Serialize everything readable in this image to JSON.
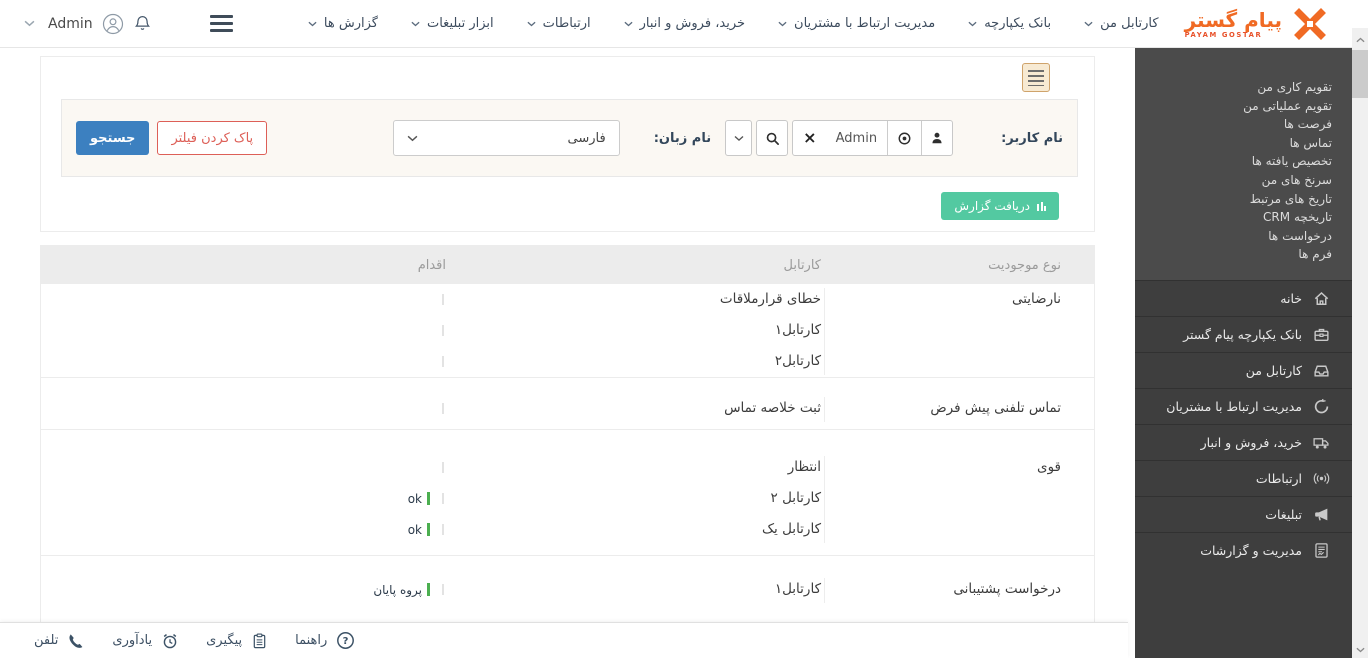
{
  "colors": {
    "accent_orange": "#f06a24",
    "primary_blue": "#3c80c0",
    "danger_red": "#dd5f57",
    "success_green": "#53c9a1",
    "action_green_bar": "#4caf50",
    "sidebar_dark": "#3e3e3e",
    "sidebar_light": "#4b4b4b"
  },
  "topbar": {
    "user_menu": {
      "name": "Admin"
    },
    "nav_items": [
      "کارتابل من",
      "بانک یکپارچه",
      "مدیریت ارتباط با مشتریان",
      "خرید، فروش و انبار",
      "ارتباطات",
      "ابزار تبلیغات",
      "گزارش ها"
    ],
    "logo": {
      "title": "پیام گستر",
      "subtitle": "PAYAM GOSTAR"
    }
  },
  "sidebar": {
    "quick_links": [
      "تقویم کاری من",
      "تقویم عملیاتی من",
      "فرصت ها",
      "تماس ها",
      "تخصیص یافته ها",
      "سرنخ های من",
      "تاریخ های مرتبط",
      "تاریخچه CRM",
      "درخواست ها",
      "فرم ها"
    ],
    "menu_items": [
      {
        "label": "خانه",
        "icon": "home-icon"
      },
      {
        "label": "بانک یکپارچه پیام گستر",
        "icon": "bank-icon"
      },
      {
        "label": "کارتابل من",
        "icon": "cartable-icon"
      },
      {
        "label": "مدیریت ارتباط با مشتریان",
        "icon": "crm-icon"
      },
      {
        "label": "خرید، فروش و انبار",
        "icon": "truck-icon"
      },
      {
        "label": "ارتباطات",
        "icon": "broadcast-icon"
      },
      {
        "label": "تبلیغات",
        "icon": "megaphone-icon"
      },
      {
        "label": "مدیریت و گزارشات",
        "icon": "reports-icon"
      }
    ]
  },
  "filter_panel": {
    "user_label": "نام کاربر:",
    "user_value": "Admin",
    "language_label": "نام زبان:",
    "language_value": "فارسی",
    "search_button": "جستجو",
    "clear_filter_button": "پاک کردن فیلتر",
    "get_report_button": "دریافت گزارش"
  },
  "table": {
    "headers": {
      "entity_type": "نوع موجودیت",
      "cartable": "کارتابل",
      "action": "اقدام"
    },
    "groups": [
      {
        "entity_type": "نارضایتی",
        "rows": [
          {
            "cartable": "خطای قرارملاقات",
            "action": ""
          },
          {
            "cartable": "کارتابل۱",
            "action": ""
          },
          {
            "cartable": "کارتابل۲",
            "action": ""
          }
        ]
      },
      {
        "entity_type": "تماس تلفنی پیش فرض",
        "rows": [
          {
            "cartable": "ثبت خلاصه تماس",
            "action": ""
          }
        ]
      },
      {
        "entity_type": "قوی",
        "rows": [
          {
            "cartable": "انتظار",
            "action": ""
          },
          {
            "cartable": "کارتابل ۲",
            "action": "ok"
          },
          {
            "cartable": "کارتابل یک",
            "action": "ok"
          }
        ]
      },
      {
        "entity_type": "درخواست پشتیبانی",
        "rows": [
          {
            "cartable": "کارتابل۱",
            "action": "پروه پایان"
          }
        ]
      }
    ]
  },
  "footer": {
    "items": [
      {
        "label": "تلفن",
        "icon": "phone-icon"
      },
      {
        "label": "یادآوری",
        "icon": "alarm-icon"
      },
      {
        "label": "پیگیری",
        "icon": "followup-icon"
      },
      {
        "label": "راهنما",
        "icon": "help-icon"
      }
    ]
  }
}
